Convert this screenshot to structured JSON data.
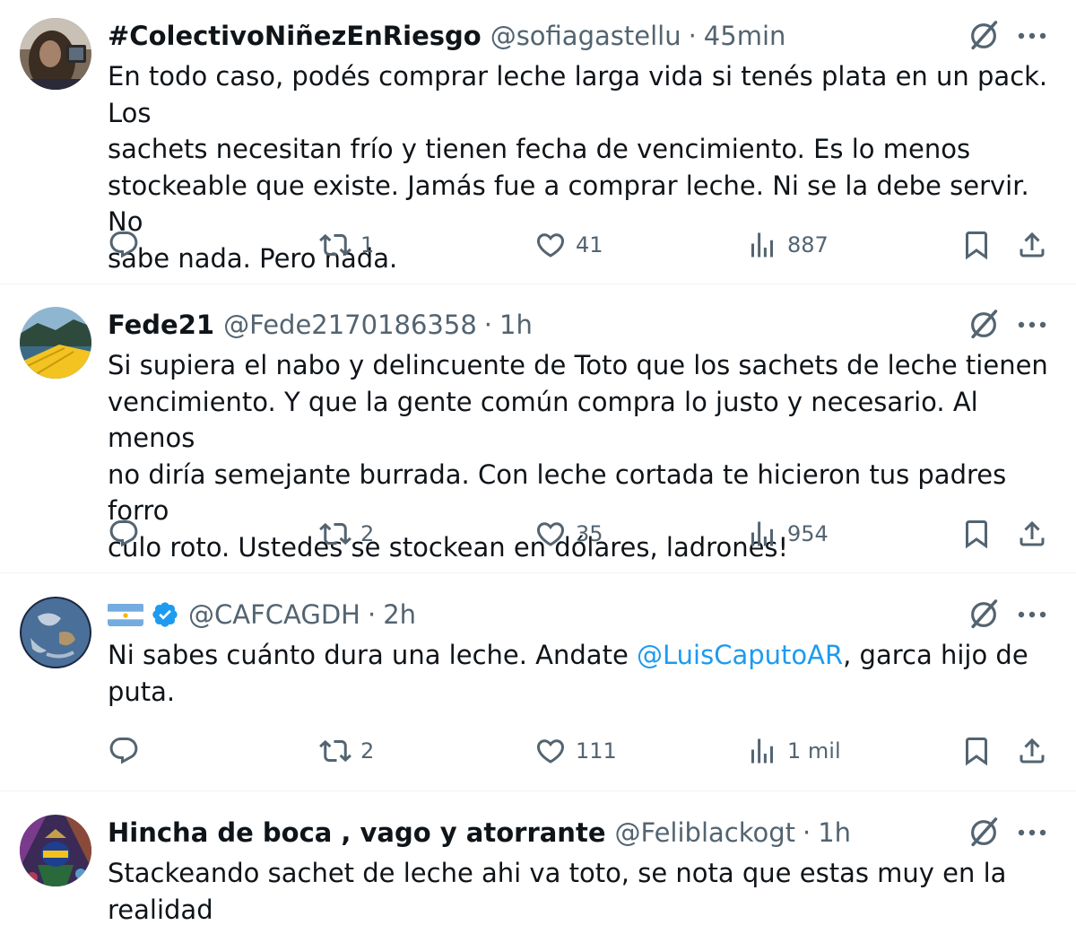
{
  "colors": {
    "text": "#0f1419",
    "secondary": "#536471",
    "link": "#1d9bf0",
    "divider": "#eff3f4",
    "verified": "#1d9bf0"
  },
  "tweets": [
    {
      "name": "#ColectivoNiñezEnRiesgo",
      "handle": "@sofiagastellu",
      "separator": "·",
      "time": "45min",
      "lines": [
        "En todo caso, podés comprar leche larga vida si tenés plata en un pack. Los",
        "sachets necesitan frío y tienen fecha de vencimiento. Es lo menos",
        "stockeable que existe. Jamás fue a comprar leche. Ni se la debe servir. No",
        "sabe nada. Pero nada."
      ],
      "retweets": "1",
      "likes": "41",
      "views": "887"
    },
    {
      "name": "Fede21",
      "handle": "@Fede2170186358",
      "separator": "·",
      "time": "1h",
      "lines": [
        "Si supiera el nabo y delincuente de Toto que los sachets de leche tienen",
        "vencimiento.  Y que la gente común compra lo justo y necesario. Al menos",
        "no diría semejante burrada. Con leche cortada te hicieron tus padres forro",
        "culo roto. Ustedes se stockean en dólares, ladrones!"
      ],
      "retweets": "2",
      "likes": "35",
      "views": "954"
    },
    {
      "name": "",
      "display_icons": [
        "argentina-flag-icon",
        "verified-badge-icon"
      ],
      "handle": "@CAFCAGDH",
      "separator": "·",
      "time": "2h",
      "line1_before": "Ni sabes cuánto dura una leche. Andate ",
      "mention": "@LuisCaputoAR",
      "line1_after": ", garca hijo de",
      "line2": "puta.",
      "retweets": "2",
      "likes": "111",
      "views": "1 mil"
    },
    {
      "name": "Hincha de boca , vago y atorrante",
      "handle": "@Feliblackogt",
      "separator": "·",
      "time": "1h",
      "lines": [
        "Stackeando sachet de leche ahi va toto, se nota que estas muy en la",
        "realidad"
      ]
    }
  ]
}
